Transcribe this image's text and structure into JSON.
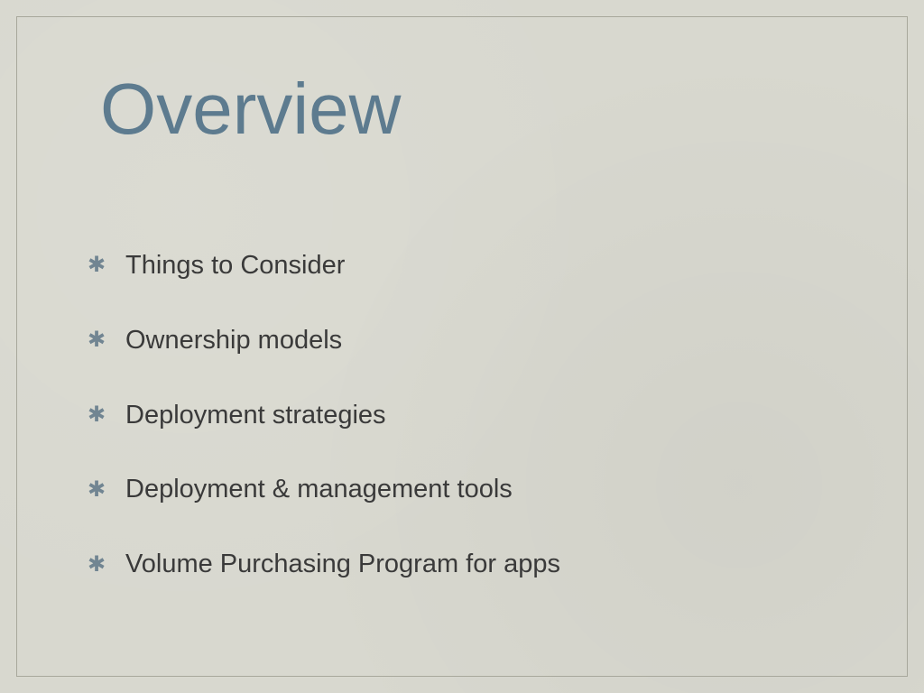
{
  "slide": {
    "title": "Overview",
    "bullets": [
      "Things to Consider",
      "Ownership models",
      "Deployment strategies",
      "Deployment & management tools",
      "Volume Purchasing Program for apps"
    ]
  }
}
